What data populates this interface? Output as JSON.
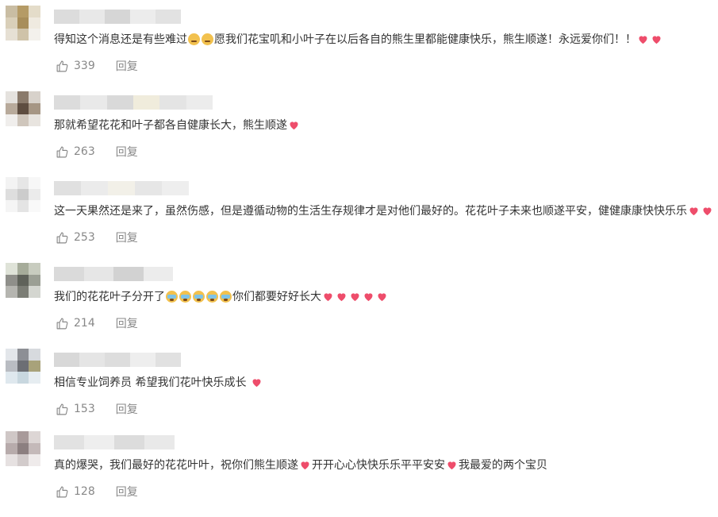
{
  "colors": {
    "text": "#333333",
    "meta": "#888888",
    "heart": "#ee4d6b"
  },
  "comments": [
    {
      "text_parts": [
        "得知这个消息还是有些难过",
        "[cry]",
        "[cry]",
        "愿我们花宝叽和小叶子在以后各自的熊生里都能健康快乐，熊生顺遂！永远爱你们！！",
        "[heart]",
        "[heart]"
      ],
      "likes": "339",
      "reply_label": "回复"
    },
    {
      "text_parts": [
        "那就希望花花和叶子都各自健康长大，熊生顺遂",
        "[heart]"
      ],
      "likes": "263",
      "reply_label": "回复"
    },
    {
      "text_parts": [
        "这一天果然还是来了，虽然伤感，但是遵循动物的生活生存规律才是对他们最好的。花花叶子未来也顺遂平安，健健康康快快乐乐",
        "[heart]",
        "[heart]"
      ],
      "likes": "253",
      "reply_label": "回复"
    },
    {
      "text_parts": [
        "我们的花花叶子分开了",
        "[sob]",
        "[sob]",
        "[sob]",
        "[sob]",
        "[sob]",
        "你们都要好好长大",
        "[heart]",
        "[heart]",
        "[heart]",
        "[heart]",
        "[heart]"
      ],
      "likes": "214",
      "reply_label": "回复"
    },
    {
      "text_parts": [
        "相信专业饲养员 希望我们花叶快乐成长 ",
        "[heart]"
      ],
      "likes": "153",
      "reply_label": "回复"
    },
    {
      "text_parts": [
        "真的爆哭，我们最好的花花叶叶，祝你们熊生顺遂",
        "[heart]",
        "开开心心快快乐乐平平安安",
        "[heart]",
        "我最爱的两个宝贝"
      ],
      "likes": "128",
      "reply_label": "回复"
    }
  ]
}
